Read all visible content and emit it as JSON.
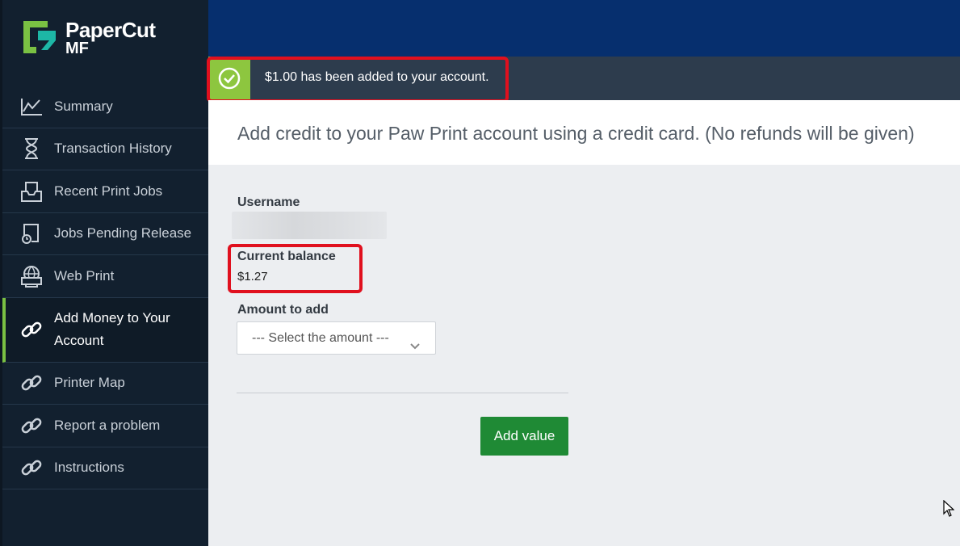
{
  "app": {
    "brand_name": "PaperCut",
    "brand_sub": "MF"
  },
  "sidebar": {
    "items": [
      {
        "label": "Summary",
        "icon": "chart-line-icon"
      },
      {
        "label": "Transaction History",
        "icon": "hourglass-icon"
      },
      {
        "label": "Recent Print Jobs",
        "icon": "print-tray-icon"
      },
      {
        "label": "Jobs Pending Release",
        "icon": "pending-jobs-icon"
      },
      {
        "label": "Web Print",
        "icon": "globe-printer-icon"
      },
      {
        "label": "Add Money to Your Account",
        "icon": "link-icon",
        "active": true
      },
      {
        "label": "Printer Map",
        "icon": "link-icon"
      },
      {
        "label": "Report a problem",
        "icon": "link-icon"
      },
      {
        "label": "Instructions",
        "icon": "link-icon"
      }
    ]
  },
  "notice": {
    "message": "$1.00 has been added to your account.",
    "icon": "check-circle-icon"
  },
  "header": {
    "text": "Add credit to your Paw Print account using a credit card. (No refunds will be given)"
  },
  "form": {
    "username_label": "Username",
    "balance_label": "Current balance",
    "balance_value": "$1.27",
    "amount_label": "Amount to add",
    "amount_select": "--- Select the amount ---",
    "submit_label": "Add value"
  },
  "colors": {
    "sidebar_bg": "#12202f",
    "topbar_bg": "#062f6e",
    "success_green": "#8dc63f",
    "button_green": "#1f8a35",
    "highlight_red": "#e0101e"
  }
}
